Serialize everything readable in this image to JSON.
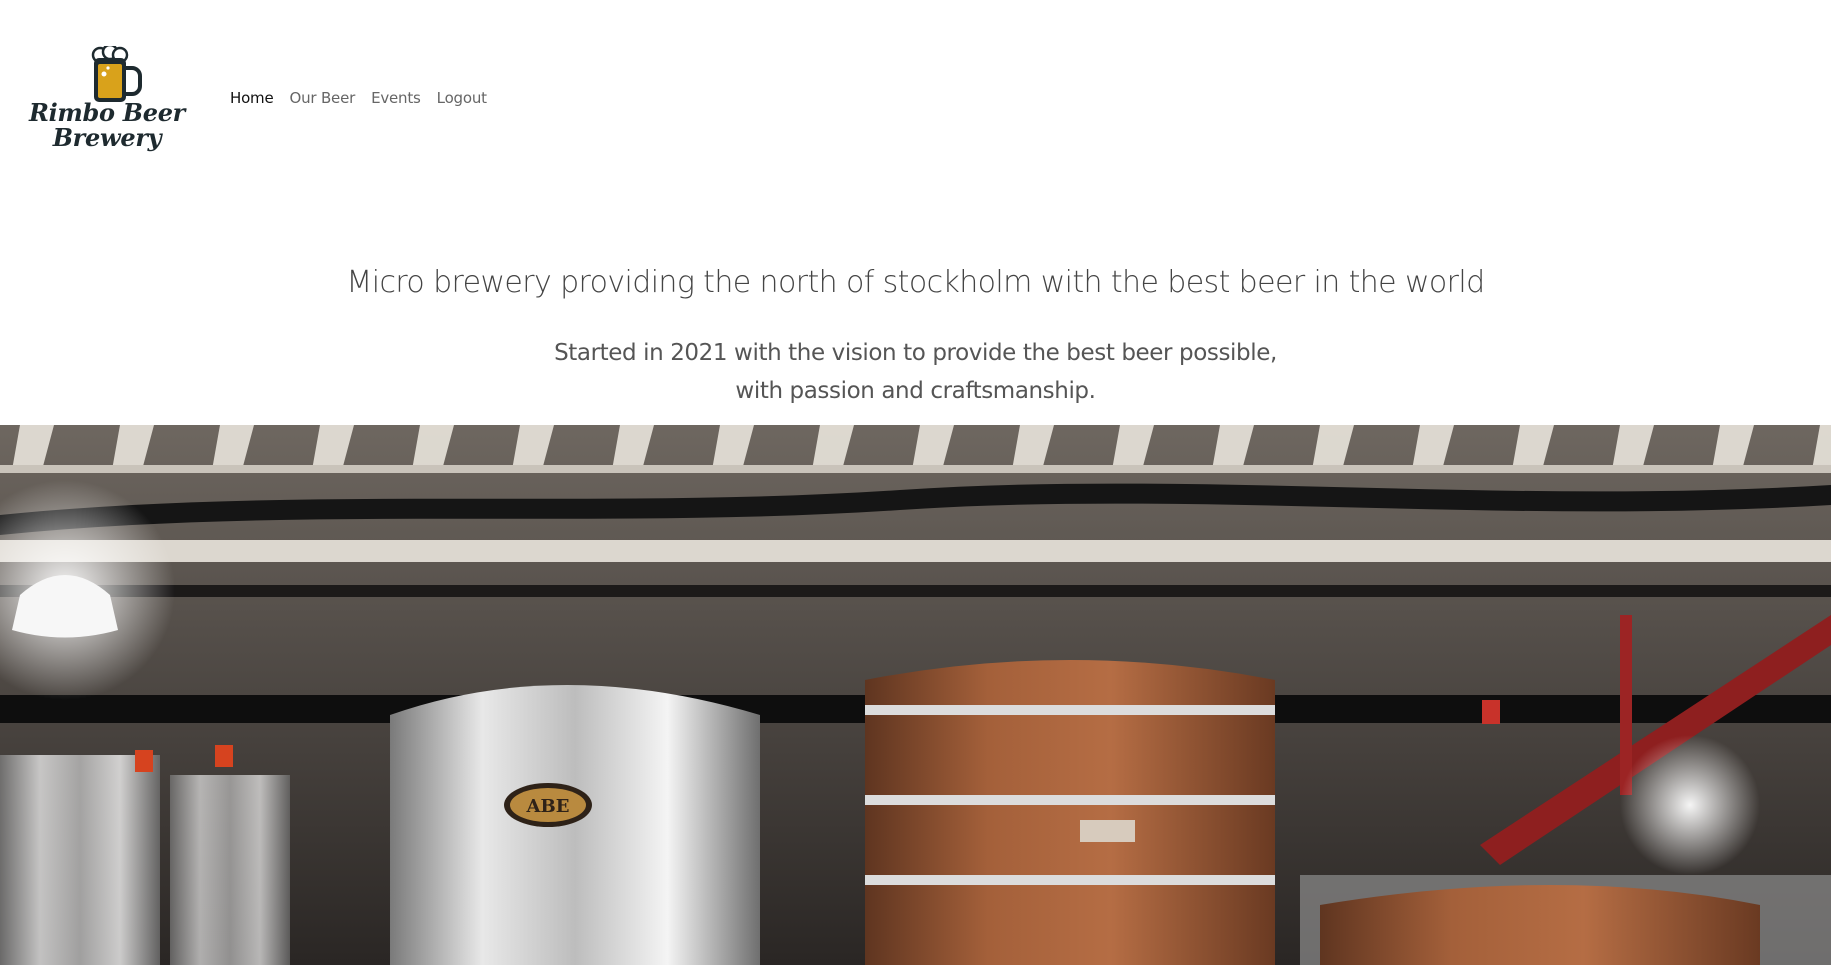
{
  "brand": {
    "name_line1": "Rimbo Beer",
    "name_line2": "Brewery",
    "logo_icon": "beer-mug-icon"
  },
  "nav": {
    "items": [
      {
        "label": "Home",
        "active": true
      },
      {
        "label": "Our Beer",
        "active": false
      },
      {
        "label": "Events",
        "active": false
      },
      {
        "label": "Logout",
        "active": false
      }
    ]
  },
  "main": {
    "headline": "Micro brewery providing the north of stockholm with the best beer in the world",
    "subtext_line1": "Started in 2021 with the vision to provide the best beer possible,",
    "subtext_line2": "with passion and craftsmanship."
  },
  "hero": {
    "tank_label": "ABE"
  },
  "colors": {
    "text_dark": "#1e2a2f",
    "beer_gold": "#d9a21b",
    "copper": "#9a5630",
    "steel": "#c8c8c8"
  }
}
